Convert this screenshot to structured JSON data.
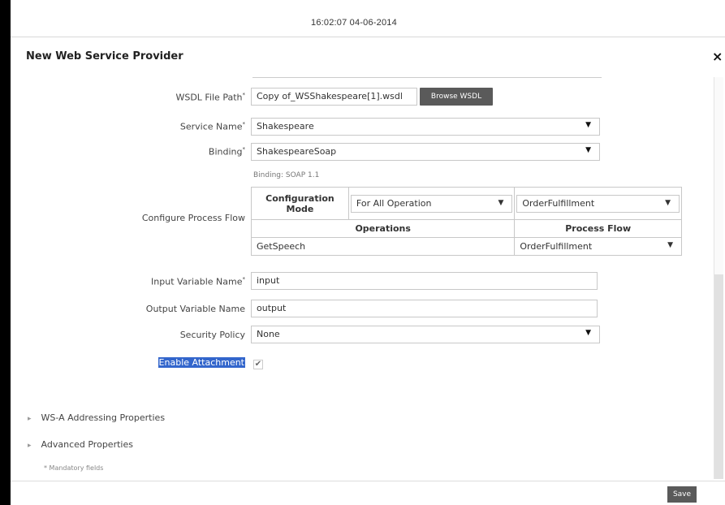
{
  "header": {
    "timestamp": "16:02:07 04-06-2014"
  },
  "dialog": {
    "title": "New Web Service Provider",
    "close": "×"
  },
  "form": {
    "wsdl_label": "WSDL File Path",
    "wsdl_value": "Copy of_WSShakespeare[1].wsdl",
    "browse_label": "Browse WSDL",
    "service_label": "Service Name",
    "service_value": "Shakespeare",
    "binding_label": "Binding",
    "binding_value": "ShakespeareSoap",
    "binding_note": "Binding: SOAP 1.1",
    "process_label": "Configure Process Flow",
    "config_mode_label": "Configuration Mode",
    "config_mode_value": "For All Operation",
    "config_flow_value": "OrderFulfillment",
    "col_operations": "Operations",
    "col_process_flow": "Process Flow",
    "row_operation": "GetSpeech",
    "row_process_flow": "OrderFulfillment",
    "input_var_label": "Input Variable Name",
    "input_var_value": "input",
    "output_var_label": "Output Variable Name",
    "output_var_value": "output",
    "security_label": "Security Policy",
    "security_value": "None",
    "attachment_label": "Enable Attachment",
    "attachment_checked": true
  },
  "sections": {
    "ws_addressing": "WS-A Addressing Properties",
    "advanced": "Advanced Properties",
    "mandatory_note": "* Mandatory fields"
  },
  "footer": {
    "save_label": "Save"
  },
  "colors": {
    "button_bg": "#5a5a5a",
    "highlight": "#3366cc"
  }
}
